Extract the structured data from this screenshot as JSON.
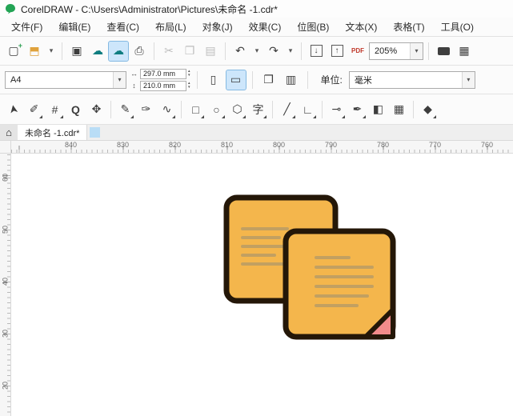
{
  "window": {
    "title": "CorelDRAW - C:\\Users\\Administrator\\Pictures\\未命名 -1.cdr*"
  },
  "menu": {
    "items": [
      "文件(F)",
      "编辑(E)",
      "查看(C)",
      "布局(L)",
      "对象(J)",
      "效果(C)",
      "位图(B)",
      "文本(X)",
      "表格(T)",
      "工具(O)"
    ]
  },
  "toolbar": {
    "new_glyph": "▢",
    "new_overlay": "+",
    "open_glyph": "⬒",
    "open_caret": "▾",
    "save_glyph": "▣",
    "cloud_down_glyph": "☁",
    "cloud_up_glyph": "☁",
    "print_glyph": "⎙",
    "cut_glyph": "✂",
    "copy_glyph": "❐",
    "paste_glyph": "▤",
    "undo_glyph": "↶",
    "undo_caret": "▾",
    "redo_glyph": "↷",
    "redo_caret": "▾",
    "import_glyph": "↓",
    "export_glyph": "↑",
    "pdf_label": "PDF",
    "zoom_value": "205%",
    "zoom_caret": "▾",
    "grid_glyph": "▦"
  },
  "property_bar": {
    "page_size_value": "A4",
    "combo_caret": "▾",
    "width_value": "297.0 mm",
    "height_value": "210.0 mm",
    "width_icon": "↔",
    "height_icon": "↕",
    "spin_up": "▴",
    "spin_down": "▾",
    "portrait_glyph": "▯",
    "landscape_glyph": "▭",
    "all_pages_glyph": "❐",
    "current_page_glyph": "▥",
    "units_label": "单位:",
    "units_value": "毫米"
  },
  "toolbox": {
    "tools": [
      {
        "name": "pick-tool",
        "glyph": "➤"
      },
      {
        "name": "shape-tool",
        "glyph": "✐"
      },
      {
        "name": "crop-tool",
        "glyph": "#"
      },
      {
        "name": "zoom-tool",
        "glyph": "Q"
      },
      {
        "name": "pan-tool",
        "glyph": "✥"
      },
      {
        "name": "freehand-tool",
        "glyph": "✎"
      },
      {
        "name": "artistic-media-tool",
        "glyph": "✑"
      },
      {
        "name": "bezier-tool",
        "glyph": "∿"
      },
      {
        "name": "rectangle-tool",
        "glyph": "□"
      },
      {
        "name": "ellipse-tool",
        "glyph": "○"
      },
      {
        "name": "polygon-tool",
        "glyph": "⬡"
      },
      {
        "name": "text-tool",
        "glyph": "字"
      },
      {
        "name": "line-tool",
        "glyph": "╱"
      },
      {
        "name": "connector-tool",
        "glyph": "∟"
      },
      {
        "name": "eyedropper-tool",
        "glyph": "⊸"
      },
      {
        "name": "outline-pen-tool",
        "glyph": "✒"
      },
      {
        "name": "smart-fill-tool",
        "glyph": "◧"
      },
      {
        "name": "transparency-tool",
        "glyph": "▦"
      },
      {
        "name": "interactive-fill-tool",
        "glyph": "◆"
      }
    ]
  },
  "tabs": {
    "home_glyph": "⌂",
    "active_label": "未命名 -1.cdr*"
  },
  "rulers": {
    "horizontal": [
      "840",
      "830",
      "820",
      "810",
      "800",
      "790",
      "780",
      "770",
      "760"
    ],
    "vertical": [
      "60",
      "50",
      "40",
      "30",
      "20"
    ]
  },
  "canvas": {
    "illustration": {
      "note_fill": "#F4B64C",
      "outline": "#241708",
      "line_color": "#C2A061",
      "fold_color": "#F28B8B"
    }
  }
}
